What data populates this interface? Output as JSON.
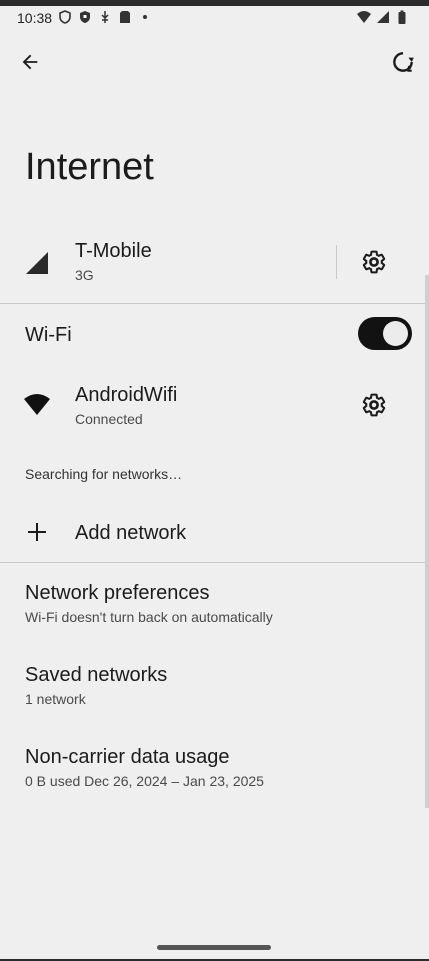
{
  "status_bar": {
    "time": "10:38"
  },
  "app_bar": {
    "back_icon": "arrow-back-icon",
    "refresh_icon": "refresh-icon"
  },
  "page": {
    "title": "Internet"
  },
  "carrier": {
    "name": "T-Mobile",
    "network_type": "3G",
    "icon": "cellular-signal-icon",
    "settings_icon": "gear-icon"
  },
  "wifi": {
    "label": "Wi-Fi",
    "enabled": true
  },
  "connected_network": {
    "name": "AndroidWifi",
    "status": "Connected",
    "icon": "wifi-icon",
    "settings_icon": "gear-icon"
  },
  "searching_text": "Searching for networks…",
  "add_network": {
    "label": "Add network",
    "icon": "plus-icon"
  },
  "network_preferences": {
    "title": "Network preferences",
    "subtitle": "Wi‑Fi doesn't turn back on automatically"
  },
  "saved_networks": {
    "title": "Saved networks",
    "subtitle": "1 network"
  },
  "data_usage": {
    "title": "Non-carrier data usage",
    "subtitle": "0 B used Dec 26, 2024 – Jan 23, 2025"
  },
  "colors": {
    "background": "#efefef",
    "toggle_on": "#121212",
    "text_primary": "#1b1b1b",
    "text_secondary": "#4a4a4a"
  }
}
